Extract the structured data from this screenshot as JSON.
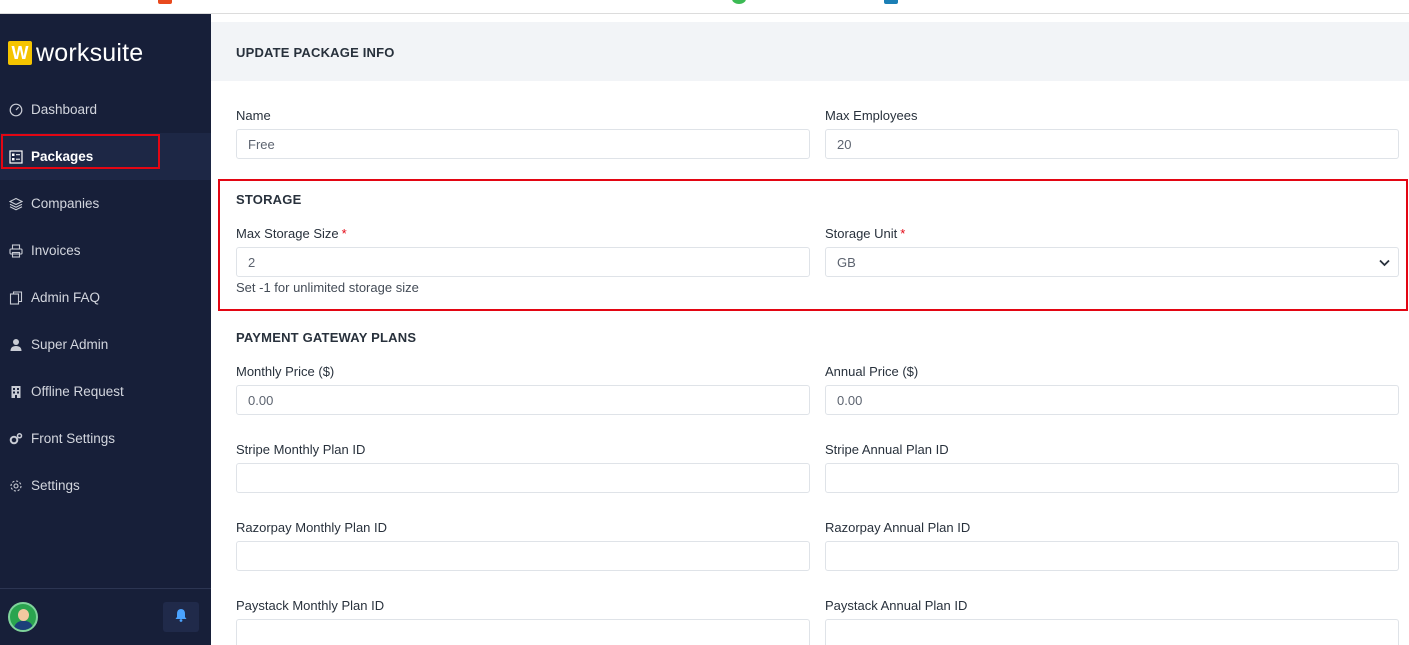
{
  "brand": {
    "mark": "W",
    "name": "worksuite"
  },
  "sidebar": {
    "items": [
      {
        "label": "Dashboard",
        "icon": "dashboard-gauge-icon"
      },
      {
        "label": "Packages",
        "icon": "packages-grid-icon",
        "active": true
      },
      {
        "label": "Companies",
        "icon": "layers-icon"
      },
      {
        "label": "Invoices",
        "icon": "printer-icon"
      },
      {
        "label": "Admin FAQ",
        "icon": "documents-icon"
      },
      {
        "label": "Super Admin",
        "icon": "user-icon"
      },
      {
        "label": "Offline Request",
        "icon": "building-icon"
      },
      {
        "label": "Front Settings",
        "icon": "cogs-icon"
      },
      {
        "label": "Settings",
        "icon": "gear-icon"
      }
    ],
    "footer": {
      "avatar": "user-avatar",
      "bell": "bell-icon"
    }
  },
  "form": {
    "title": "UPDATE PACKAGE INFO",
    "name": {
      "label": "Name",
      "value": "Free"
    },
    "max_employees": {
      "label": "Max Employees",
      "value": "20"
    },
    "storage": {
      "title": "STORAGE",
      "max_size": {
        "label": "Max Storage Size",
        "required": "*",
        "value": "2"
      },
      "unit": {
        "label": "Storage Unit",
        "required": "*",
        "value": "GB"
      },
      "help": "Set -1 for unlimited storage size"
    },
    "payment": {
      "title": "PAYMENT GATEWAY PLANS",
      "monthly_price": {
        "label": "Monthly Price ($)",
        "value": "0.00"
      },
      "annual_price": {
        "label": "Annual Price ($)",
        "value": "0.00"
      },
      "stripe_monthly": {
        "label": "Stripe Monthly Plan ID",
        "value": ""
      },
      "stripe_annual": {
        "label": "Stripe Annual Plan ID",
        "value": ""
      },
      "razorpay_monthly": {
        "label": "Razorpay Monthly Plan ID",
        "value": ""
      },
      "razorpay_annual": {
        "label": "Razorpay Annual Plan ID",
        "value": ""
      },
      "paystack_monthly": {
        "label": "Paystack Monthly Plan ID",
        "value": ""
      },
      "paystack_annual": {
        "label": "Paystack Annual Plan ID",
        "value": ""
      }
    }
  },
  "colors": {
    "sidebar_bg": "#171f39",
    "brand_yellow": "#f5c400",
    "highlight_red": "#e30613",
    "header_bg": "#f2f4f7"
  }
}
